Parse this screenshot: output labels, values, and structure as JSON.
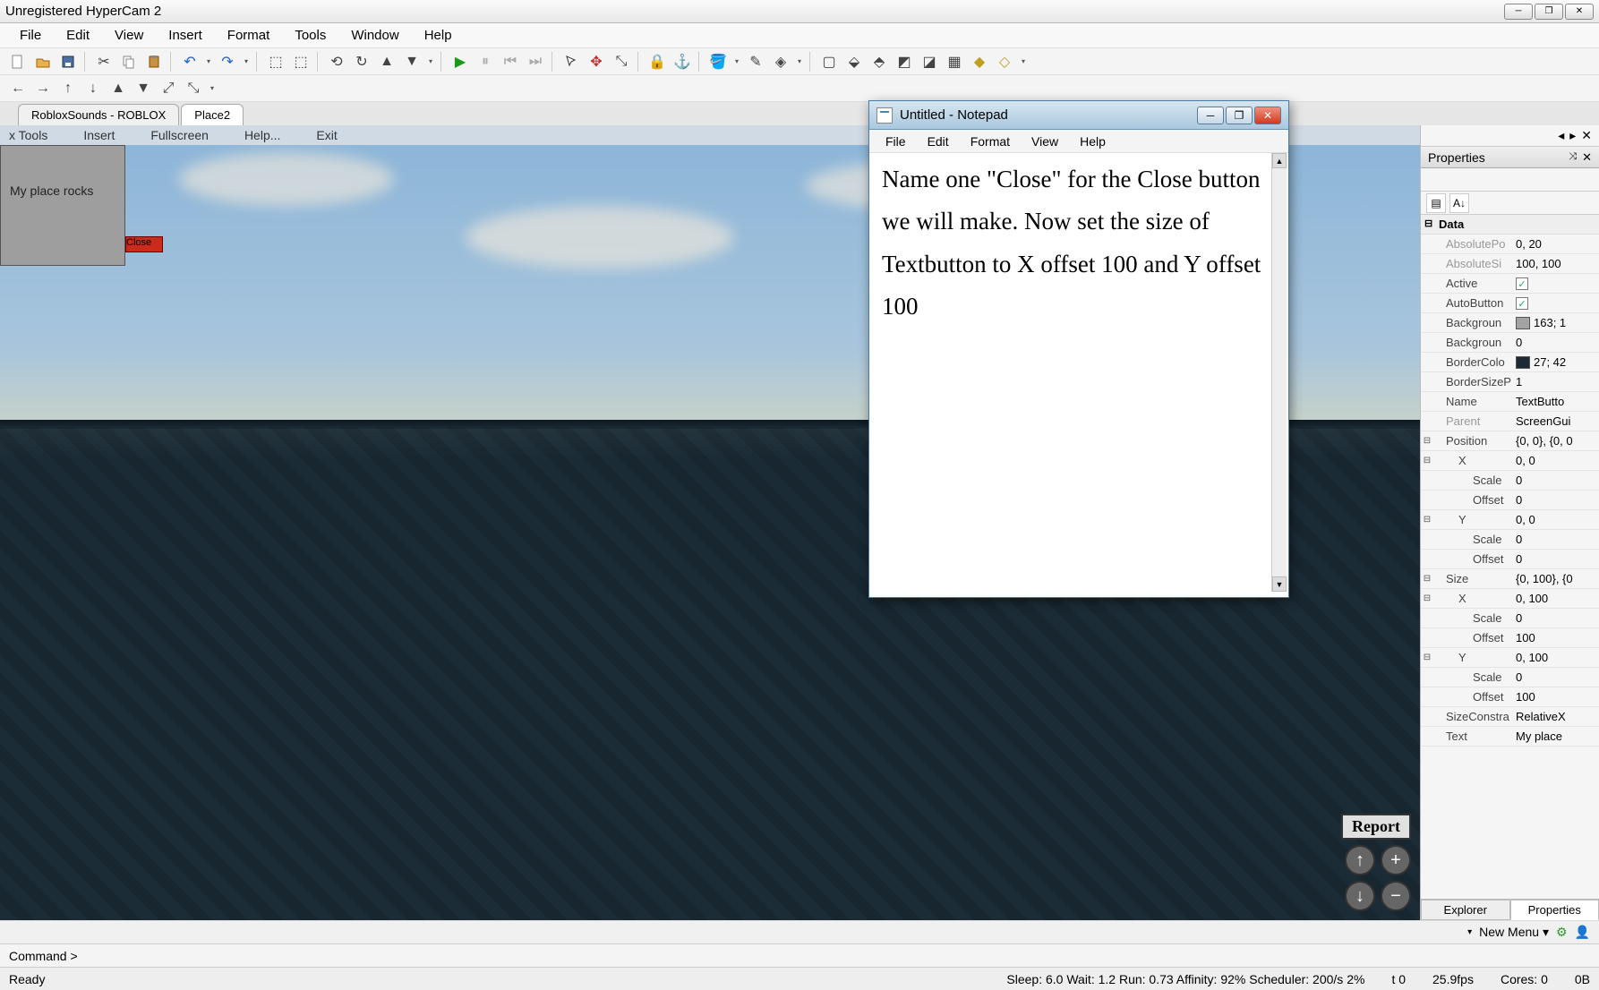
{
  "hypercam_title": "Unregistered HyperCam 2",
  "menu": {
    "file": "File",
    "edit": "Edit",
    "view": "View",
    "insert": "Insert",
    "format": "Format",
    "tools": "Tools",
    "window": "Window",
    "help": "Help"
  },
  "tabs": {
    "tab1": "RobloxSounds - ROBLOX",
    "tab2": "Place2"
  },
  "vpmenu": {
    "xtools": "x Tools",
    "insert": "Insert",
    "fullscreen": "Fullscreen",
    "help": "Help...",
    "exit": "Exit"
  },
  "gui": {
    "label": "My place rocks",
    "close": "Close"
  },
  "report": "Report",
  "properties": {
    "title": "Properties",
    "group": "Data",
    "rows": {
      "abspos_k": "AbsolutePo",
      "abspos_v": "0, 20",
      "abssize_k": "AbsoluteSi",
      "abssize_v": "100, 100",
      "active_k": "Active",
      "autobtn_k": "AutoButton",
      "bgcol_k": "Backgroun",
      "bgcol_v": "163; 1",
      "bgtrans_k": "Backgroun",
      "bgtrans_v": "0",
      "bordcol_k": "BorderColo",
      "bordcol_v": "27; 42",
      "bordsize_k": "BorderSizeP",
      "bordsize_v": "1",
      "name_k": "Name",
      "name_v": "TextButto",
      "parent_k": "Parent",
      "parent_v": "ScreenGui",
      "pos_k": "Position",
      "pos_v": "{0, 0}, {0, 0",
      "x_k": "X",
      "posx_v": "0, 0",
      "scale_k": "Scale",
      "offset_k": "Offset",
      "zero": "0",
      "y_k": "Y",
      "posy_v": "0, 0",
      "size_k": "Size",
      "size_v": "{0, 100}, {0",
      "sizex_v": "0, 100",
      "hundred": "100",
      "sizey_v": "0, 100",
      "sizecon_k": "SizeConstra",
      "sizecon_v": "RelativeX",
      "text_k": "Text",
      "text_v": "My place"
    },
    "tabs": {
      "explorer": "Explorer",
      "properties": "Properties"
    }
  },
  "notepad": {
    "title": "Untitled - Notepad",
    "menu": {
      "file": "File",
      "edit": "Edit",
      "format": "Format",
      "view": "View",
      "help": "Help"
    },
    "body": "Name one \"Close\" for the Close button we will make. Now set  the size of Textbutton to X offset 100 and Y offset 100"
  },
  "command": "Command >",
  "newmenu": "New Menu ▾",
  "status": {
    "ready": "Ready",
    "perf": "Sleep: 6.0 Wait: 1.2 Run: 0.73 Affinity: 92% Scheduler: 200/s 2%",
    "t": "t 0",
    "fps": "25.9fps",
    "cores": "Cores: 0",
    "bytes": "0B"
  }
}
